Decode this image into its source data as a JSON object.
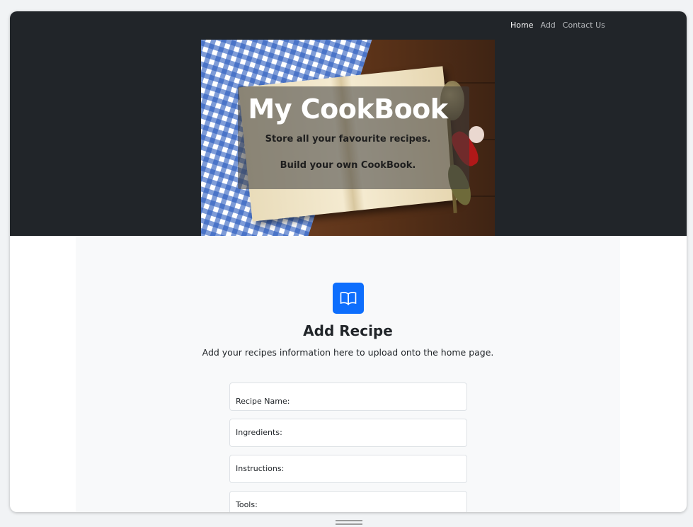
{
  "nav": {
    "items": [
      {
        "label": "Home",
        "active": true
      },
      {
        "label": "Add",
        "active": false
      },
      {
        "label": "Contact Us",
        "active": false
      }
    ]
  },
  "hero": {
    "title": "My CookBook",
    "line1": "Store all your favourite recipes.",
    "line2": "Build your own CookBook."
  },
  "form": {
    "icon": "open-book-icon",
    "title": "Add Recipe",
    "description": "Add your recipes information here to upload onto the home page.",
    "fields": {
      "recipe_name": "Recipe Name:",
      "ingredients": "Ingredients:",
      "instructions": "Instructions:",
      "tools": "Tools:"
    }
  },
  "colors": {
    "header_bg": "#212529",
    "accent": "#0d6efd",
    "content_bg": "#f8f9fa"
  }
}
